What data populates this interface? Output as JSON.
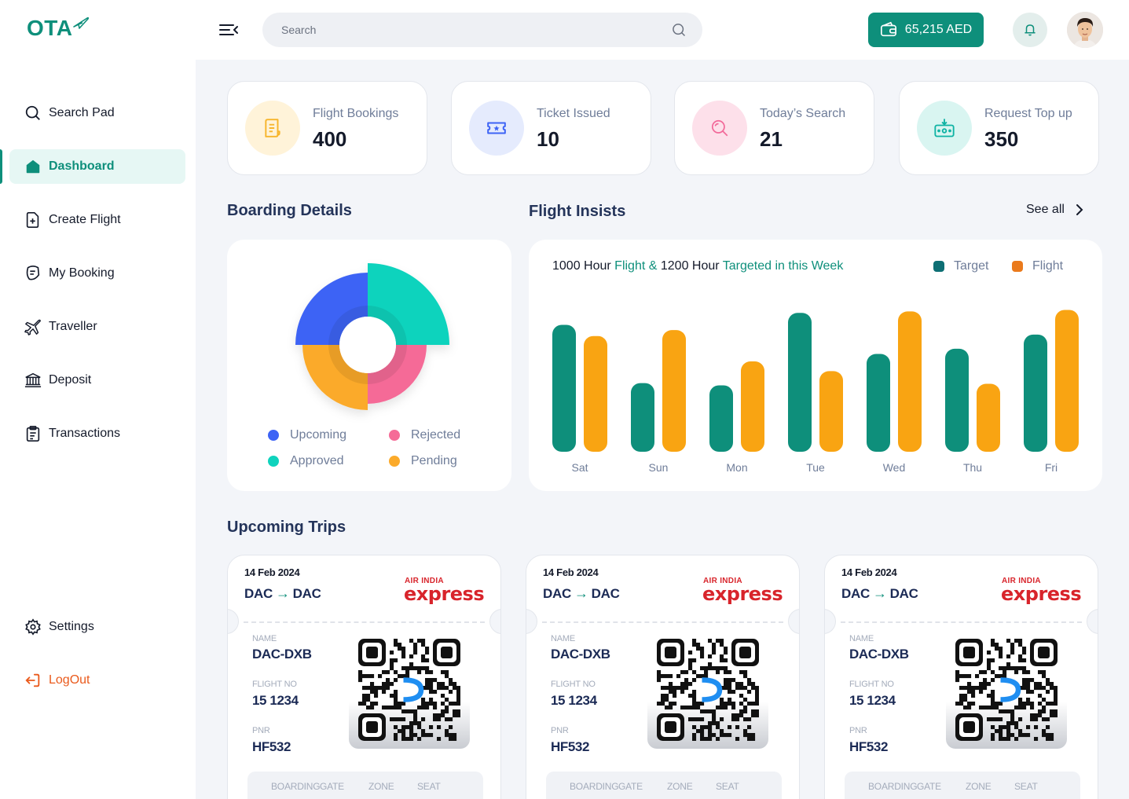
{
  "brand": {
    "name": "OTA"
  },
  "sidebar": {
    "items": [
      {
        "label": "Search Pad",
        "icon": "search-icon"
      },
      {
        "label": "Dashboard",
        "icon": "home-icon"
      },
      {
        "label": "Create Flight",
        "icon": "file-plus-icon"
      },
      {
        "label": "My Booking",
        "icon": "booking-icon"
      },
      {
        "label": "Traveller",
        "icon": "plane-icon"
      },
      {
        "label": "Deposit",
        "icon": "bank-icon"
      },
      {
        "label": "Transactions",
        "icon": "clipboard-icon"
      }
    ],
    "settings_label": "Settings",
    "logout_label": "LogOut"
  },
  "topbar": {
    "search_placeholder": "Search",
    "wallet_balance": "65,215 AED"
  },
  "stats": [
    {
      "label": "Flight Bookings",
      "value": "400",
      "color": "#f7b52b"
    },
    {
      "label": "Ticket Issued",
      "value": "10",
      "color": "#3d63f5"
    },
    {
      "label": "Today’s Search",
      "value": "21",
      "color": "#f26a9a"
    },
    {
      "label": "Request Top up",
      "value": "350",
      "color": "#0fb3a4"
    }
  ],
  "boarding": {
    "title": "Boarding Details",
    "legend": [
      "Upcoming",
      "Rejected",
      "Approved",
      "Pending"
    ]
  },
  "insights": {
    "title": "Flight Insists",
    "see_all": "See all",
    "caption_1": "1000 Hour",
    "caption_2": "Flight &",
    "caption_3": "1200 Hour",
    "caption_4": "Targeted in this Week",
    "legend_target": "Target",
    "legend_flight": "Flight"
  },
  "chart_data": [
    {
      "type": "pie",
      "labels": [
        "Approved",
        "Rejected",
        "Pending",
        "Upcoming"
      ],
      "values": [
        25,
        25,
        25,
        25
      ],
      "colors": [
        "#0fd3bd",
        "#f56b97",
        "#fbaa2a",
        "#3d63f5"
      ]
    },
    {
      "type": "bar",
      "categories": [
        "Sat",
        "Sun",
        "Mon",
        "Tue",
        "Wed",
        "Thu",
        "Fri"
      ],
      "series": [
        {
          "name": "Target",
          "values": [
            170,
            92,
            89,
            186,
            131,
            138,
            157
          ],
          "color": "#0e8f7b"
        },
        {
          "name": "Flight",
          "values": [
            155,
            163,
            121,
            108,
            188,
            91,
            190
          ],
          "color": "#f9a412"
        }
      ],
      "ylim": [
        0,
        200
      ]
    }
  ],
  "trips": {
    "title": "Upcoming Trips",
    "cards": [
      {
        "date": "14 Feb 2024",
        "from": "DAC",
        "to": "DAC",
        "airline_top": "AIR INDIA",
        "airline_bottom": "express",
        "name_label": "NAME",
        "name": "DAC-DXB",
        "flight_label": "FLIGHT NO",
        "flight_no": "15 1234",
        "pnr_label": "PNR",
        "pnr": "HF532",
        "footer": [
          "BOARDING",
          "GATE",
          "ZONE",
          "SEAT"
        ]
      },
      {
        "date": "14 Feb 2024",
        "from": "DAC",
        "to": "DAC",
        "airline_top": "AIR INDIA",
        "airline_bottom": "express",
        "name_label": "NAME",
        "name": "DAC-DXB",
        "flight_label": "FLIGHT NO",
        "flight_no": "15 1234",
        "pnr_label": "PNR",
        "pnr": "HF532",
        "footer": [
          "BOARDING",
          "GATE",
          "ZONE",
          "SEAT"
        ]
      },
      {
        "date": "14 Feb 2024",
        "from": "DAC",
        "to": "DAC",
        "airline_top": "AIR INDIA",
        "airline_bottom": "express",
        "name_label": "NAME",
        "name": "DAC-DXB",
        "flight_label": "FLIGHT NO",
        "flight_no": "15 1234",
        "pnr_label": "PNR",
        "pnr": "HF532",
        "footer": [
          "BOARDING",
          "GATE",
          "ZONE",
          "SEAT"
        ]
      }
    ]
  }
}
